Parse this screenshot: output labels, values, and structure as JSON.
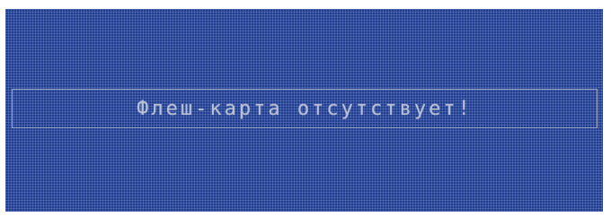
{
  "screen": {
    "background_color": "#1f3c8f",
    "grid_color": "#96aae1",
    "message": {
      "text": "Флеш-карта отсутствует!",
      "text_color": "#b8bfd4",
      "border_color": "#9aa4bf"
    }
  }
}
